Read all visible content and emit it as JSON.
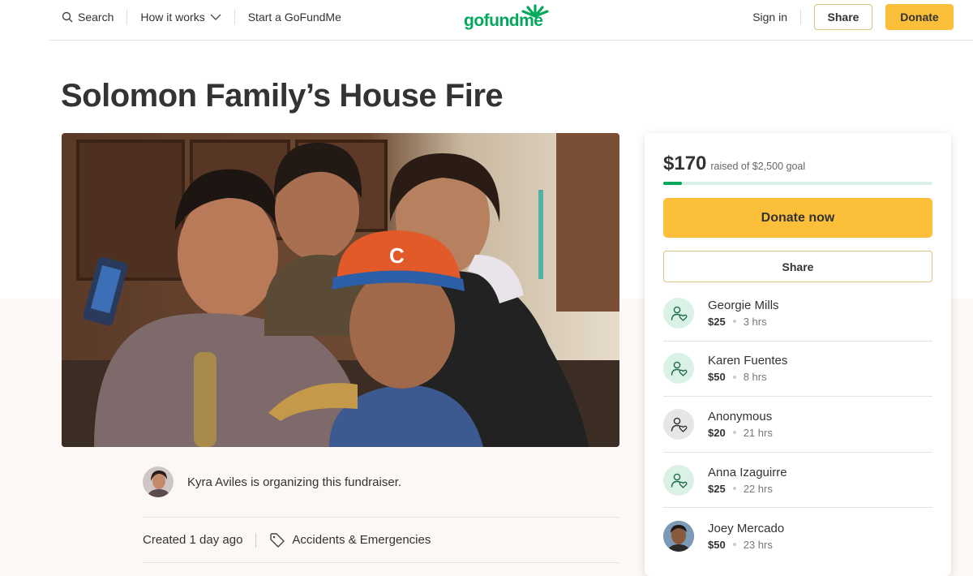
{
  "header": {
    "search_label": "Search",
    "how_it_works_label": "How it works",
    "start_label": "Start a GoFundMe",
    "logo_text": "gofundme",
    "sign_in_label": "Sign in",
    "share_label": "Share",
    "donate_label": "Donate"
  },
  "campaign": {
    "title": "Solomon Family’s House Fire",
    "organizer_text": "Kyra Aviles is organizing this fundraiser.",
    "created": "Created 1 day ago",
    "category": "Accidents & Emergencies"
  },
  "sidebar": {
    "raised_amount": "$170",
    "raised_goal": "raised of $2,500 goal",
    "progress_fraction": 0.068,
    "donate_now_label": "Donate now",
    "share_label": "Share",
    "donors": [
      {
        "name": "Georgie Mills",
        "amount": "$25",
        "time": "3 hrs",
        "icon": "donor-heart-icon",
        "color": "#daf1e6"
      },
      {
        "name": "Karen Fuentes",
        "amount": "$50",
        "time": "8 hrs",
        "icon": "donor-heart-icon",
        "color": "#daf1e6"
      },
      {
        "name": "Anonymous",
        "amount": "$20",
        "time": "21 hrs",
        "icon": "donor-heart-icon",
        "color": "#e6e6e6"
      },
      {
        "name": "Anna Izaguirre",
        "amount": "$25",
        "time": "22 hrs",
        "icon": "donor-heart-icon",
        "color": "#daf1e6"
      },
      {
        "name": "Joey Mercado",
        "amount": "$50",
        "time": "23 hrs",
        "icon": "donor-avatar",
        "color": "#8a6a50"
      }
    ]
  },
  "colors": {
    "brand_green": "#02a95c",
    "donate_yellow": "#fbbf3a",
    "progress_track": "#daf1e6"
  }
}
